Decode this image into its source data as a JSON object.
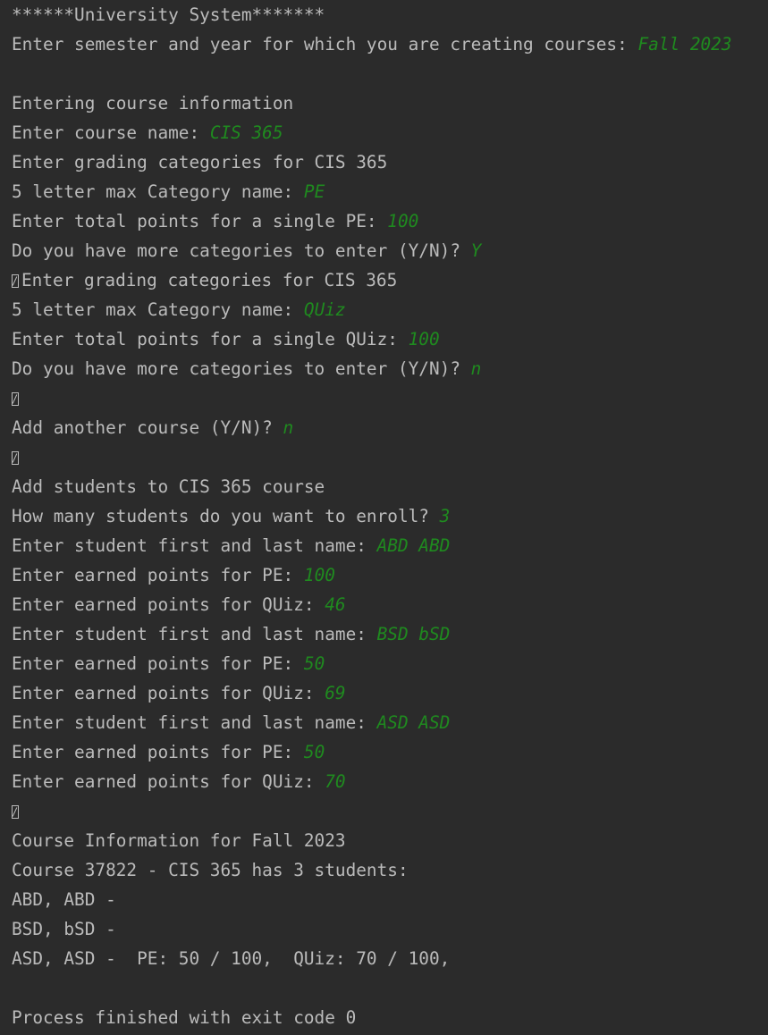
{
  "console": {
    "lines": [
      {
        "prompt": "******University System*******",
        "input": ""
      },
      {
        "prompt": "Enter semester and year for which you are creating courses: ",
        "input": "Fall 2023"
      },
      {
        "prompt": "",
        "input": ""
      },
      {
        "prompt": "Entering course information",
        "input": ""
      },
      {
        "prompt": "Enter course name: ",
        "input": "CIS 365"
      },
      {
        "prompt": "Enter grading categories for CIS 365",
        "input": ""
      },
      {
        "prompt": "5 letter max Category name: ",
        "input": "PE"
      },
      {
        "prompt": "Enter total points for a single PE: ",
        "input": "100"
      },
      {
        "prompt": "Do you have more categories to enter (Y/N)? ",
        "input": "Y"
      },
      {
        "prompt": "Enter grading categories for CIS 365",
        "input": "",
        "glyph": true
      },
      {
        "prompt": "5 letter max Category name: ",
        "input": "QUiz"
      },
      {
        "prompt": "Enter total points for a single QUiz: ",
        "input": "100"
      },
      {
        "prompt": "Do you have more categories to enter (Y/N)? ",
        "input": "n"
      },
      {
        "prompt": "",
        "input": "",
        "glyph": true
      },
      {
        "prompt": "Add another course (Y/N)? ",
        "input": "n"
      },
      {
        "prompt": "",
        "input": "",
        "glyph": true
      },
      {
        "prompt": "Add students to CIS 365 course",
        "input": ""
      },
      {
        "prompt": "How many students do you want to enroll? ",
        "input": "3"
      },
      {
        "prompt": "Enter student first and last name: ",
        "input": "ABD ABD"
      },
      {
        "prompt": "Enter earned points for PE: ",
        "input": "100"
      },
      {
        "prompt": "Enter earned points for QUiz: ",
        "input": "46"
      },
      {
        "prompt": "Enter student first and last name: ",
        "input": "BSD bSD"
      },
      {
        "prompt": "Enter earned points for PE: ",
        "input": "50"
      },
      {
        "prompt": "Enter earned points for QUiz: ",
        "input": "69"
      },
      {
        "prompt": "Enter student first and last name: ",
        "input": "ASD ASD"
      },
      {
        "prompt": "Enter earned points for PE: ",
        "input": "50"
      },
      {
        "prompt": "Enter earned points for QUiz: ",
        "input": "70"
      },
      {
        "prompt": "",
        "input": "",
        "glyph": true
      },
      {
        "prompt": "Course Information for Fall 2023",
        "input": ""
      },
      {
        "prompt": "Course 37822 - CIS 365 has 3 students:",
        "input": ""
      },
      {
        "prompt": "ABD, ABD - ",
        "input": ""
      },
      {
        "prompt": "BSD, bSD - ",
        "input": ""
      },
      {
        "prompt": "ASD, ASD -  PE: 50 / 100,  QUiz: 70 / 100,",
        "input": ""
      },
      {
        "prompt": "",
        "input": ""
      },
      {
        "prompt": "Process finished with exit code 0",
        "input": ""
      }
    ]
  },
  "colors": {
    "background": "#2b2b2b",
    "text": "#bbbbbb",
    "user_input": "#1f8a1f"
  }
}
